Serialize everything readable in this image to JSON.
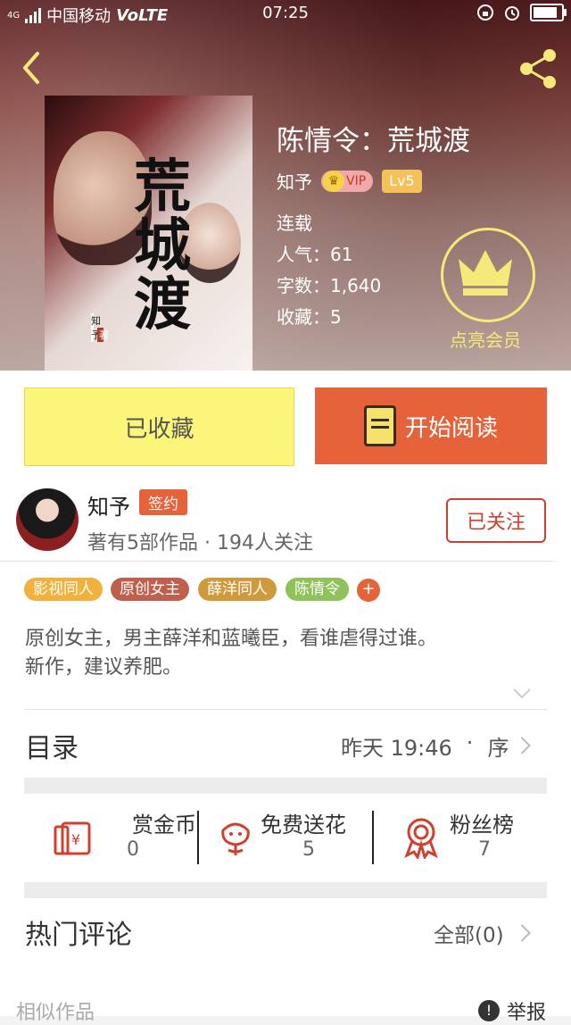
{
  "status_bar": {
    "carrier": "中国移动",
    "network": "VoLTE",
    "signal_tag": "4G",
    "time": "07:25"
  },
  "book": {
    "title": "陈情令：荒城渡",
    "author": "知予",
    "vip_label": "VIP",
    "level": "Lv5",
    "status": "连载",
    "popularity": "人气：61",
    "word_count": "字数：1,640",
    "favorites": "收藏：5",
    "cover_title": "荒城渡",
    "cover_author": "知予",
    "cover_stamp": "著",
    "member_label": "点亮会员"
  },
  "actions": {
    "favorited_label": "已收藏",
    "read_label": "开始阅读"
  },
  "author_card": {
    "name": "知予",
    "badge": "签约",
    "stats": "著有5部作品 · 194人关注",
    "follow_label": "已关注"
  },
  "tags": [
    "影视同人",
    "原创女主",
    "薛洋同人",
    "陈情令"
  ],
  "tag_add": "+",
  "intro": {
    "line1": "原创女主，男主薛洋和蓝曦臣，看谁虐得过谁。",
    "line2": "新作，建议养肥。"
  },
  "catalog": {
    "label": "目录",
    "updated": "昨天 19:46",
    "separator": "·",
    "order": "序"
  },
  "rewards": [
    {
      "label": "赏金币",
      "count": "0"
    },
    {
      "label": "免费送花",
      "count": "5"
    },
    {
      "label": "粉丝榜",
      "count": "7"
    }
  ],
  "comments": {
    "label": "热门评论",
    "all_label": "全部(0)"
  },
  "footer": {
    "similar_label": "相似作品",
    "report_label": "举报",
    "report_icon": "!"
  },
  "colors": {
    "accent_orange": "#e6623a",
    "fav_yellow": "#fbf57a",
    "member_yellow": "#f5e97a"
  }
}
